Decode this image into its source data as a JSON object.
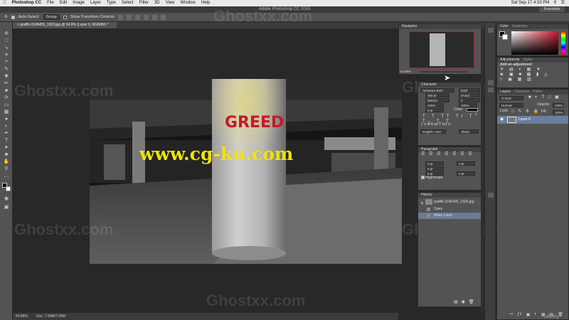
{
  "menubar": {
    "app": "Photoshop CC",
    "items": [
      "File",
      "Edit",
      "Image",
      "Layer",
      "Type",
      "Select",
      "Filter",
      "3D",
      "View",
      "Window",
      "Help"
    ],
    "clock": "Sat Sep 17  4:33 PM"
  },
  "window": {
    "title": "Adobe Photoshop CC 2015",
    "workspace": "Essentials"
  },
  "options": {
    "auto_select_label": "Auto-Select:",
    "auto_select_value": "Group",
    "transform_label": "Show Transform Controls"
  },
  "document": {
    "tab_label": "graffiti-1545455_1920.jpg @ 54.9% (Layer 0, RGB/8#) *"
  },
  "canvas": {
    "graffiti_text": "GREED",
    "url_watermark": "www.cg-ku.com",
    "brand_watermark": "Ghostxx.com"
  },
  "status": {
    "zoom": "54.86%",
    "doc": "Doc: 7.09M/7.09M"
  },
  "navigator": {
    "title": "Navigator",
    "zoom": "54.86%"
  },
  "character": {
    "title": "Character",
    "font_family": "Helvetica Bold",
    "font_style": "Bold",
    "size": "300 pt",
    "leading": "(Auto)",
    "kerning": "Metrics",
    "tracking": "0",
    "vscale": "100%",
    "hscale": "100%",
    "baseline": "0 pt",
    "color_label": "Color:",
    "language": "English: USA",
    "aa": "Sharp"
  },
  "paragraph": {
    "title": "Paragraph",
    "indent_left": "0 pt",
    "indent_right": "0 pt",
    "indent_first": "0 pt",
    "space_before": "0 pt",
    "space_after": "0 pt",
    "hyphenate": "Hyphenate"
  },
  "history": {
    "title": "History",
    "items": [
      "graffiti-1545455_1920.jpg",
      "Open",
      "Make Layer"
    ]
  },
  "color_panel": {
    "tabs": [
      "Color",
      "Swatches"
    ]
  },
  "adjustments": {
    "tabs": [
      "Adjustments",
      "Styles"
    ],
    "hint": "Add an adjustment"
  },
  "layers": {
    "tabs": [
      "Layers",
      "Channels",
      "Paths"
    ],
    "kind": "Kind",
    "blend": "Normal",
    "opacity_label": "Opacity:",
    "opacity": "100%",
    "lock_label": "Lock:",
    "fill_label": "Fill:",
    "fill": "100%",
    "layer_name": "Layer 0"
  },
  "footer": {
    "udemy": "udemy"
  },
  "colors": {
    "accent_red": "#c7182c",
    "watermark_yellow": "#f1e400",
    "selection": "#6b7e9c"
  }
}
